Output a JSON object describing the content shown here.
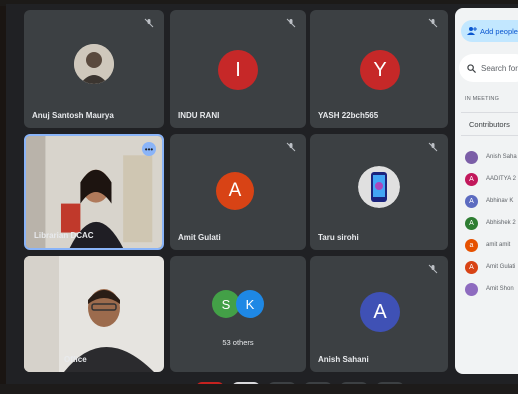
{
  "panel": {
    "add_people_label": "Add people",
    "search_placeholder": "Search for p",
    "section_label": "IN MEETING",
    "contributors_label": "Contributors",
    "participants": [
      {
        "name": "Anish Saha",
        "initial": "",
        "color": "#7b5ea7"
      },
      {
        "name": "AADITYA 2",
        "initial": "A",
        "color": "#c2185b"
      },
      {
        "name": "Abhinav K",
        "initial": "A",
        "color": "#5c6bc0"
      },
      {
        "name": "Abhishek 2",
        "initial": "A",
        "color": "#2e7d32"
      },
      {
        "name": "amit amit",
        "initial": "a",
        "color": "#e65100"
      },
      {
        "name": "Amit Gulati",
        "initial": "A",
        "color": "#d84315"
      },
      {
        "name": "Amit Shon",
        "initial": "",
        "color": "#8e6bbf"
      }
    ]
  },
  "tiles": {
    "anuj": {
      "name": "Anuj Santosh Maurya"
    },
    "indu": {
      "name": "INDU RANI",
      "initial": "I",
      "color": "#c62828"
    },
    "yash": {
      "name": "YASH 22bch565",
      "initial": "Y",
      "color": "#c62828"
    },
    "librarian": {
      "name": "Librarian DCAC"
    },
    "amit": {
      "name": "Amit Gulati",
      "initial": "A",
      "color": "#d84315"
    },
    "taru": {
      "name": "Taru sirohi"
    },
    "others": {
      "initial1": "S",
      "initial2": "K",
      "color1": "#43a047",
      "color2": "#1e88e5",
      "count_label": "53 others"
    },
    "office": {
      "name": "Office"
    },
    "anish": {
      "name": "Anish Sahani",
      "initial": "A",
      "color": "#3f51b5"
    }
  },
  "icons": {
    "mic_off": "mic-off-icon",
    "more": "more-vert-icon",
    "add_person": "person-add-icon",
    "search": "search-icon"
  },
  "colors": {
    "tile_bg": "#3c4043",
    "accent": "#8ab4f8",
    "end_call": "#c5221f"
  }
}
